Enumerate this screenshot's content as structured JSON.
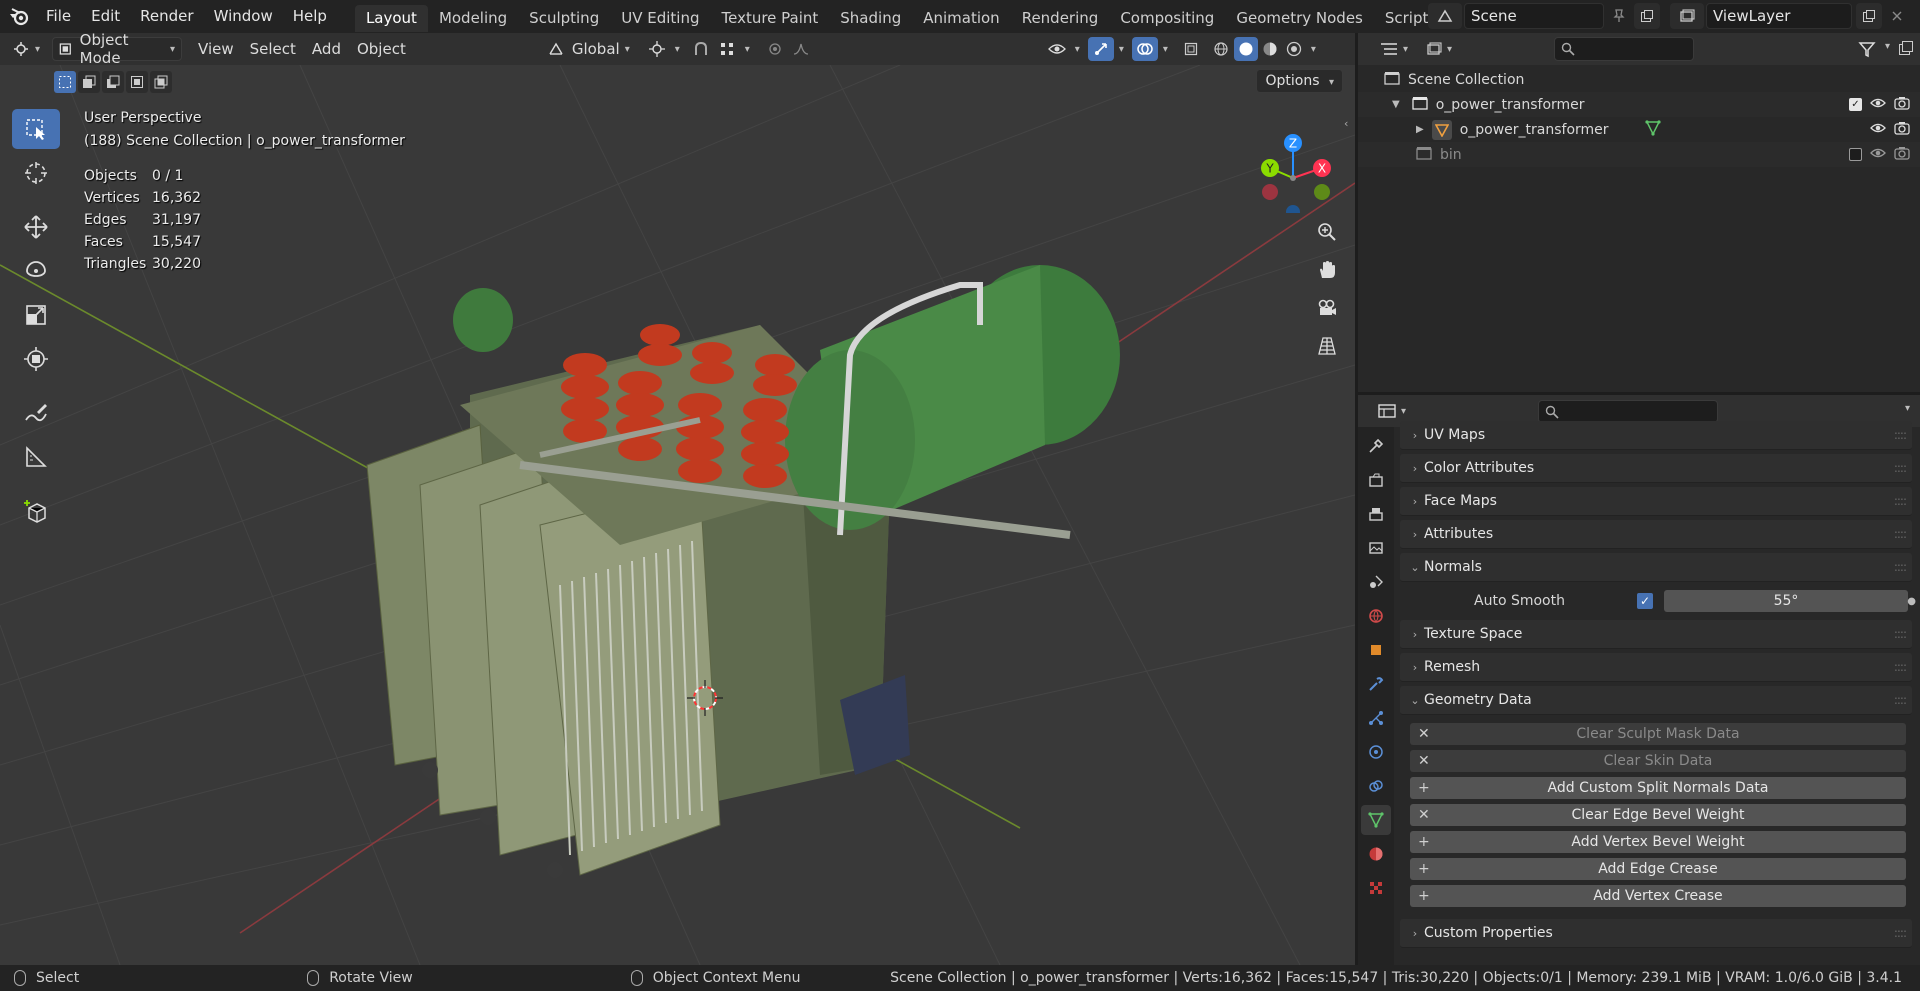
{
  "topbar": {
    "menus": [
      "File",
      "Edit",
      "Render",
      "Window",
      "Help"
    ],
    "workspaces": [
      "Layout",
      "Modeling",
      "Sculpting",
      "UV Editing",
      "Texture Paint",
      "Shading",
      "Animation",
      "Rendering",
      "Compositing",
      "Geometry Nodes",
      "Scripting"
    ],
    "active_workspace": "Layout",
    "add_workspace": "+",
    "scene_name": "Scene",
    "view_layer": "ViewLayer"
  },
  "viewport": {
    "mode": "Object Mode",
    "menus": [
      "View",
      "Select",
      "Add",
      "Object"
    ],
    "transform_orientation": "Global",
    "options_label": "Options",
    "perspective_label": "User Perspective",
    "collection_label": "(188) Scene Collection | o_power_transformer",
    "stats": [
      {
        "key": "Objects",
        "value": "0 / 1"
      },
      {
        "key": "Vertices",
        "value": "16,362"
      },
      {
        "key": "Edges",
        "value": "31,197"
      },
      {
        "key": "Faces",
        "value": "15,547"
      },
      {
        "key": "Triangles",
        "value": "30,220"
      }
    ],
    "gizmo": {
      "x": "X",
      "y": "Y",
      "z": "Z"
    }
  },
  "outliner": {
    "root": "Scene Collection",
    "items": [
      {
        "label": "o_power_transformer",
        "kind": "collection"
      },
      {
        "label": "o_power_transformer",
        "kind": "object"
      },
      {
        "label": "bin",
        "kind": "collection"
      }
    ]
  },
  "properties": {
    "panels_top": [
      "UV Maps",
      "Color Attributes",
      "Face Maps",
      "Attributes"
    ],
    "normals": {
      "title": "Normals",
      "auto_smooth_label": "Auto Smooth",
      "angle": "55°"
    },
    "panels_mid": [
      "Texture Space",
      "Remesh"
    ],
    "geometry_data": {
      "title": "Geometry Data",
      "buttons": [
        {
          "label": "Clear Sculpt Mask Data",
          "symbol": "✕",
          "enabled": false
        },
        {
          "label": "Clear Skin Data",
          "symbol": "✕",
          "enabled": false
        },
        {
          "label": "Add Custom Split Normals Data",
          "symbol": "+",
          "enabled": true
        },
        {
          "label": "Clear Edge Bevel Weight",
          "symbol": "✕",
          "enabled": true
        },
        {
          "label": "Add Vertex Bevel Weight",
          "symbol": "+",
          "enabled": true
        },
        {
          "label": "Add Edge Crease",
          "symbol": "+",
          "enabled": true
        },
        {
          "label": "Add Vertex Crease",
          "symbol": "+",
          "enabled": true
        }
      ]
    },
    "panels_bottom": [
      "Custom Properties"
    ]
  },
  "statusbar": {
    "select": "Select",
    "rotate": "Rotate View",
    "context": "Object Context Menu",
    "info": "Scene Collection | o_power_transformer | Verts:16,362 | Faces:15,547 | Tris:30,220 | Objects:0/1 | Memory: 239.1 MiB | VRAM: 1.0/6.0 GiB | 3.4.1"
  },
  "colors": {
    "accent": "#4772b3",
    "axis_x": "#ff3352",
    "axis_y": "#8bdc00",
    "axis_z": "#2890ff"
  }
}
